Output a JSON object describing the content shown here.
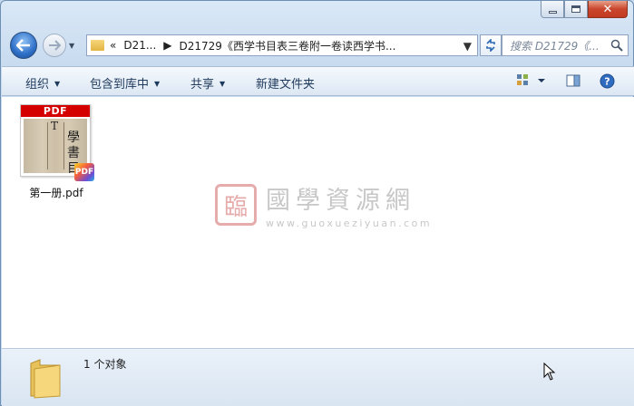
{
  "window": {
    "minimize_label": "",
    "close_label": "✕"
  },
  "nav": {
    "back_label": "",
    "forward_label": ""
  },
  "address": {
    "overflow": "«",
    "crumb1": "D21...",
    "crumb2": "D21729《西学书目表三卷附一卷读西学书..."
  },
  "search": {
    "placeholder": "搜索 D21729《..."
  },
  "toolbar": {
    "organize": "组织",
    "include_library": "包含到库中",
    "share": "共享",
    "new_folder": "新建文件夹"
  },
  "files": [
    {
      "name": "第一册.pdf",
      "thumb_band": "PDF",
      "badge": "PDF",
      "thumb_chars": [
        "學",
        "書",
        "目"
      ],
      "thumb_T": "T"
    }
  ],
  "watermark": {
    "seal": "臨",
    "main": "國學資源網",
    "url": "www.guoxueziyuan.com"
  },
  "status": {
    "count_text": "1 个对象"
  },
  "colors": {
    "accent": "#2e6fc7",
    "close_red": "#c9462c",
    "pdf_red": "#d40000"
  }
}
